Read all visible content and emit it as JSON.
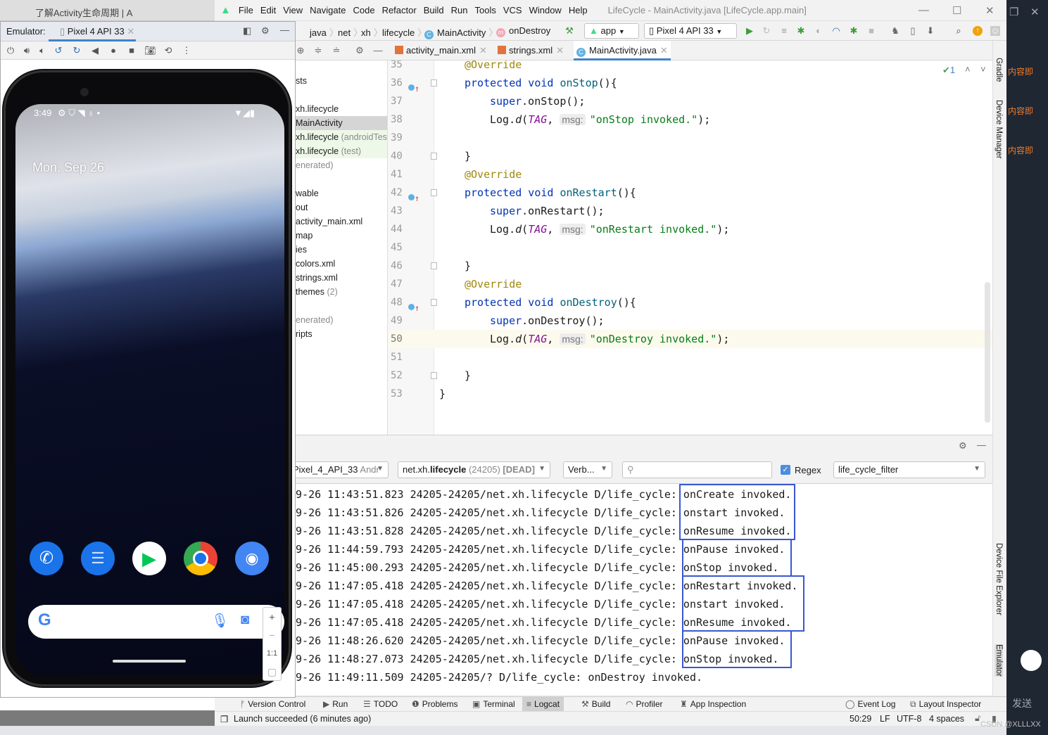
{
  "browser": {
    "tab_title": "了解Activity生命周期 | A"
  },
  "ide": {
    "menu": [
      "File",
      "Edit",
      "View",
      "Navigate",
      "Code",
      "Refactor",
      "Build",
      "Run",
      "Tools",
      "VCS",
      "Window",
      "Help"
    ],
    "window_title": "LifeCycle - MainActivity.java [LifeCycle.app.main]",
    "breadcrumb": [
      "java",
      "net",
      "xh",
      "lifecycle",
      "MainActivity",
      "onDestroy"
    ],
    "run_config": "app",
    "device": "Pixel 4 API 33",
    "editor_tabs": [
      {
        "label": "activity_main.xml",
        "active": false
      },
      {
        "label": "strings.xml",
        "active": false
      },
      {
        "label": "MainActivity.java",
        "active": true
      }
    ],
    "project_tree": [
      {
        "text": "sts",
        "note": ""
      },
      {
        "text": "",
        "note": ""
      },
      {
        "text": "xh.lifecycle",
        "note": ""
      },
      {
        "text": "MainActivity",
        "note": "",
        "selected": true
      },
      {
        "text": "xh.lifecycle",
        "note": " (androidTes",
        "tint": true
      },
      {
        "text": "xh.lifecycle",
        "note": " (test)",
        "tint": true
      },
      {
        "text": "",
        "note": "enerated)"
      },
      {
        "text": "",
        "note": ""
      },
      {
        "text": "wable",
        "note": ""
      },
      {
        "text": "out",
        "note": ""
      },
      {
        "text": "activity_main.xml",
        "note": ""
      },
      {
        "text": "map",
        "note": ""
      },
      {
        "text": "ies",
        "note": ""
      },
      {
        "text": "colors.xml",
        "note": ""
      },
      {
        "text": "strings.xml",
        "note": ""
      },
      {
        "text": "themes",
        "note": " (2)"
      },
      {
        "text": "",
        "note": ""
      },
      {
        "text": "",
        "note": "enerated)"
      },
      {
        "text": "ripts",
        "note": ""
      }
    ],
    "inspection_count": "1",
    "code": {
      "current_line": 50,
      "lines": [
        {
          "n": "35",
          "ind": 1,
          "t": [
            [
              "@Override",
              "ann"
            ]
          ]
        },
        {
          "n": "36",
          "ind": 1,
          "ovr": true,
          "fold": true,
          "t": [
            [
              "protected void ",
              "kw"
            ],
            [
              "onStop",
              "fn"
            ],
            [
              "(){",
              ""
            ]
          ]
        },
        {
          "n": "37",
          "ind": 2,
          "t": [
            [
              "super",
              "kw"
            ],
            [
              ".onStop();",
              ""
            ]
          ]
        },
        {
          "n": "38",
          "ind": 2,
          "t": [
            [
              "Log.",
              ""
            ],
            [
              "d",
              "it"
            ],
            [
              "(",
              ""
            ],
            [
              "TAG",
              "tag"
            ],
            [
              ", ",
              ""
            ],
            [
              "msg:",
              "hint"
            ],
            [
              "\"onStop invoked.\"",
              "str"
            ],
            [
              ");",
              ""
            ]
          ]
        },
        {
          "n": "39",
          "ind": 0,
          "t": []
        },
        {
          "n": "40",
          "ind": 1,
          "fold": true,
          "t": [
            [
              "}",
              ""
            ]
          ]
        },
        {
          "n": "41",
          "ind": 1,
          "t": [
            [
              "@Override",
              "ann"
            ]
          ]
        },
        {
          "n": "42",
          "ind": 1,
          "ovr": true,
          "fold": true,
          "t": [
            [
              "protected void ",
              "kw"
            ],
            [
              "onRestart",
              "fn"
            ],
            [
              "(){",
              ""
            ]
          ]
        },
        {
          "n": "43",
          "ind": 2,
          "t": [
            [
              "super",
              "kw"
            ],
            [
              ".onRestart();",
              ""
            ]
          ]
        },
        {
          "n": "44",
          "ind": 2,
          "t": [
            [
              "Log.",
              ""
            ],
            [
              "d",
              "it"
            ],
            [
              "(",
              ""
            ],
            [
              "TAG",
              "tag"
            ],
            [
              ", ",
              ""
            ],
            [
              "msg:",
              "hint"
            ],
            [
              "\"onRestart invoked.\"",
              "str"
            ],
            [
              ");",
              ""
            ]
          ]
        },
        {
          "n": "45",
          "ind": 0,
          "t": []
        },
        {
          "n": "46",
          "ind": 1,
          "fold": true,
          "t": [
            [
              "}",
              ""
            ]
          ]
        },
        {
          "n": "47",
          "ind": 1,
          "t": [
            [
              "@Override",
              "ann"
            ]
          ]
        },
        {
          "n": "48",
          "ind": 1,
          "ovr": true,
          "fold": true,
          "t": [
            [
              "protected void ",
              "kw"
            ],
            [
              "onDestroy",
              "fn"
            ],
            [
              "(){",
              ""
            ]
          ]
        },
        {
          "n": "49",
          "ind": 2,
          "t": [
            [
              "super",
              "kw"
            ],
            [
              ".onDestroy();",
              ""
            ]
          ]
        },
        {
          "n": "50",
          "ind": 2,
          "t": [
            [
              "Log.",
              ""
            ],
            [
              "d",
              "it"
            ],
            [
              "(",
              ""
            ],
            [
              "TAG",
              "tag"
            ],
            [
              ", ",
              ""
            ],
            [
              "msg:",
              "hint"
            ],
            [
              "\"onDestroy invoked.\"",
              "str"
            ],
            [
              ");",
              ""
            ]
          ]
        },
        {
          "n": "51",
          "ind": 0,
          "t": []
        },
        {
          "n": "52",
          "ind": 1,
          "fold": true,
          "t": [
            [
              "}",
              ""
            ]
          ]
        },
        {
          "n": "53",
          "ind": 0,
          "t": [
            [
              "}",
              ""
            ]
          ]
        }
      ]
    },
    "logcat": {
      "device_filter": "Pixel_4_API_33",
      "device_filter_suffix": " Andr",
      "process_prefix": "net.xh.",
      "process_bold": "lifecycle",
      "process_pid": " (24205) ",
      "process_state": "[DEAD]",
      "level": "Verb...",
      "search_value": "",
      "regex_label": "Regex",
      "regex_checked": true,
      "saved_filter": "life_cycle_filter",
      "lines": [
        {
          "prefix": "09-26 11:43:51.823 24205-24205/net.xh.lifecycle D/life_cycle: ",
          "msg": "onCreate invoked."
        },
        {
          "prefix": "09-26 11:43:51.826 24205-24205/net.xh.lifecycle D/life_cycle: ",
          "msg": "onstart invoked."
        },
        {
          "prefix": "09-26 11:43:51.828 24205-24205/net.xh.lifecycle D/life_cycle: ",
          "msg": "onResume invoked."
        },
        {
          "prefix": "09-26 11:44:59.793 24205-24205/net.xh.lifecycle D/life_cycle: ",
          "msg": "onPause invoked."
        },
        {
          "prefix": "09-26 11:45:00.293 24205-24205/net.xh.lifecycle D/life_cycle: ",
          "msg": "onStop invoked."
        },
        {
          "prefix": "09-26 11:47:05.418 24205-24205/net.xh.lifecycle D/life_cycle: ",
          "msg": "onRestart invoked."
        },
        {
          "prefix": "09-26 11:47:05.418 24205-24205/net.xh.lifecycle D/life_cycle: ",
          "msg": "onstart invoked."
        },
        {
          "prefix": "09-26 11:47:05.418 24205-24205/net.xh.lifecycle D/life_cycle: ",
          "msg": "onResume invoked."
        },
        {
          "prefix": "09-26 11:48:26.620 24205-24205/net.xh.lifecycle D/life_cycle: ",
          "msg": "onPause invoked."
        },
        {
          "prefix": "09-26 11:48:27.073 24205-24205/net.xh.lifecycle D/life_cycle: ",
          "msg": "onStop invoked."
        },
        {
          "prefix": "09-26 11:49:11.509 24205-24205/? D/life_cycle: ",
          "msg": "onDestroy invoked."
        }
      ],
      "highlight_groups": [
        [
          0,
          2
        ],
        [
          3,
          4
        ],
        [
          5,
          7
        ],
        [
          8,
          9
        ]
      ],
      "highlight_color": "#3b57d1"
    },
    "tool_tabs": [
      "Version Control",
      "Run",
      "TODO",
      "Problems",
      "Terminal",
      "Logcat",
      "Build",
      "Profiler",
      "App Inspection"
    ],
    "active_tool_tab": "Logcat",
    "tool_tabs_right": [
      "Event Log",
      "Layout Inspector"
    ],
    "side_tools": [
      "Gradle",
      "Device Manager",
      "Device File Explorer",
      "Emulator"
    ],
    "status": {
      "message": "Launch succeeded (6 minutes ago)",
      "position": "50:29",
      "line_sep": "LF",
      "encoding": "UTF-8",
      "indent": "4 spaces"
    }
  },
  "emulator": {
    "label": "Emulator:",
    "tab": "Pixel 4 API 33",
    "phone": {
      "time": "3:49",
      "date": "Mon, Sep 26",
      "dock": [
        "phone-app",
        "messages-app",
        "play-store-app",
        "chrome-app",
        "camera-app"
      ]
    },
    "zoom": {
      "in": "+",
      "out": "−",
      "actual": "1:1"
    }
  },
  "side_panel": {
    "snippets": [
      "内容即",
      "内容即",
      "内容即"
    ],
    "send": "发送",
    "watermark": "CSDN @XLLLXX"
  },
  "colors": {
    "accent": "#4083c9",
    "keyword": "#0033b3",
    "string": "#067d17",
    "annotation": "#9e880d",
    "field": "#871094"
  }
}
